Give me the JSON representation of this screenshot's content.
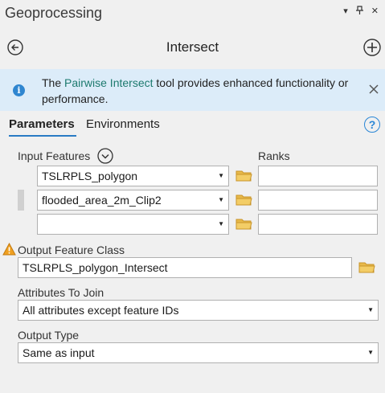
{
  "window": {
    "title": "Geoprocessing",
    "menu_glyph": "▾",
    "pin_glyph": "⊓",
    "close_glyph": "✕"
  },
  "tool": {
    "name": "Intersect"
  },
  "info": {
    "prefix": "The ",
    "link": "Pairwise Intersect",
    "suffix": " tool provides enhanced functionality or performance.",
    "icon_glyph": "i",
    "accent": "#2f86d0"
  },
  "tabs": [
    {
      "label": "Parameters",
      "active": true
    },
    {
      "label": "Environments",
      "active": false
    }
  ],
  "help_glyph": "?",
  "input_features": {
    "label": "Input Features",
    "ranks_label": "Ranks",
    "rows": [
      {
        "value": "TSLRPLS_polygon",
        "rank": ""
      },
      {
        "value": "flooded_area_2m_Clip2",
        "rank": ""
      },
      {
        "value": "",
        "rank": ""
      }
    ]
  },
  "output_feature_class": {
    "label": "Output Feature Class",
    "value": "TSLRPLS_polygon_Intersect",
    "warning_glyph": "!"
  },
  "attributes_to_join": {
    "label": "Attributes To Join",
    "value": "All attributes except feature IDs"
  },
  "output_type": {
    "label": "Output Type",
    "value": "Same as input"
  },
  "dropdown_arrow": "▼",
  "icons": {
    "back": "back-arrow-icon",
    "add": "plus-icon",
    "folder": "folder-icon",
    "warning": "warning-icon",
    "info": "info-icon"
  },
  "colors": {
    "info_bar": "#dcecf9",
    "link": "#1d7a6e",
    "tab_underline": "#2a7bc4",
    "folder": "#e8b94a",
    "warning": "#f0a020"
  }
}
